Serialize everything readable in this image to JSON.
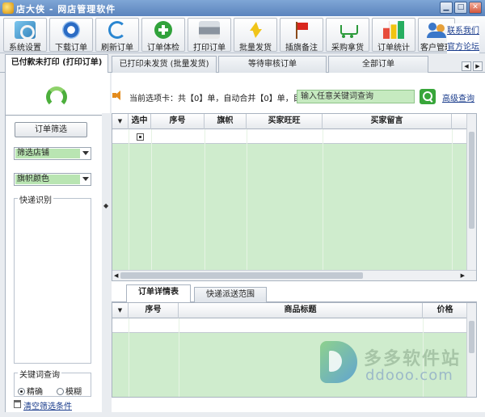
{
  "window": {
    "title": "店大侠 - 网店管理软件"
  },
  "toolbar": {
    "buttons": [
      {
        "label": "系统设置",
        "icon": "settings-icon"
      },
      {
        "label": "下载订单",
        "icon": "download-icon"
      },
      {
        "label": "刷新订单",
        "icon": "refresh-icon"
      },
      {
        "label": "订单体检",
        "icon": "check-icon"
      },
      {
        "label": "打印订单",
        "icon": "printer-icon"
      },
      {
        "label": "批量发货",
        "icon": "lightning-icon"
      },
      {
        "label": "插旗备注",
        "icon": "flag-icon"
      },
      {
        "label": "采购拿货",
        "icon": "cart-icon"
      },
      {
        "label": "订单统计",
        "icon": "bar-chart-icon"
      },
      {
        "label": "客户管理",
        "icon": "users-icon"
      }
    ],
    "contact_label": "联系我们",
    "forum_label": "官方论坛"
  },
  "tabs": [
    {
      "label": "已付款未打印 (打印订单)",
      "active": true
    },
    {
      "label": "已打印未发货 (批量发货)",
      "active": false
    },
    {
      "label": "等待审核订单",
      "active": false
    },
    {
      "label": "全部订单",
      "active": false
    }
  ],
  "sidebar": {
    "filter_button": "订单筛选",
    "shop_select": "筛选店铺",
    "flag_select": "旗帜颜色",
    "express_group": "快递识别",
    "keyword_group": "关键词查询",
    "radio_exact": "精确",
    "radio_fuzzy": "模糊",
    "clear_link": "清空筛选条件"
  },
  "main": {
    "status_text": "当前选项卡：共【0】单，自动合并【0】单，目前",
    "search_placeholder": "输入任意关键词查询",
    "advanced_search": "高级查询",
    "order_columns": [
      "选中",
      "序号",
      "旗帜",
      "买家旺旺",
      "买家留言"
    ],
    "subtabs": [
      {
        "label": "订单详情表",
        "active": true
      },
      {
        "label": "快递派送范围",
        "active": false
      }
    ],
    "detail_columns": [
      "序号",
      "商品标题",
      "价格"
    ]
  },
  "watermark": {
    "name": "多多软件站",
    "url": "ddooo.com"
  },
  "colors": {
    "grid_green": "#cfeccd",
    "accent_blue": "#1a3c8c"
  }
}
